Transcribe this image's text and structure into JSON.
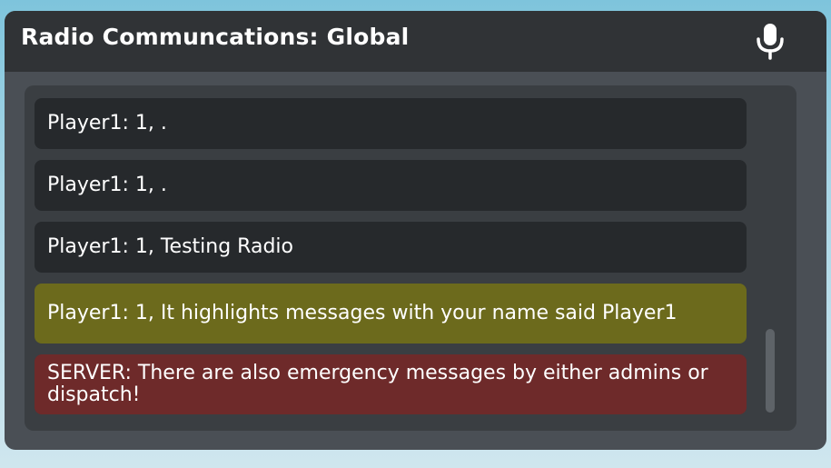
{
  "window": {
    "title": "Radio Communcations: Global",
    "icon": "microphone-icon"
  },
  "messages": [
    {
      "text": "Player1: 1, .",
      "kind": "normal"
    },
    {
      "text": "Player1: 1, .",
      "kind": "normal"
    },
    {
      "text": "Player1: 1, Testing Radio",
      "kind": "normal"
    },
    {
      "text": "Player1: 1, It highlights messages with your name said Player1",
      "kind": "highlight"
    },
    {
      "text": "SERVER: There are also emergency messages by either admins or dispatch!",
      "kind": "emergency"
    }
  ],
  "colors": {
    "normal_message": "#26292c",
    "highlight_message": "#6c6a1c",
    "emergency_message": "#6e2a2a"
  }
}
